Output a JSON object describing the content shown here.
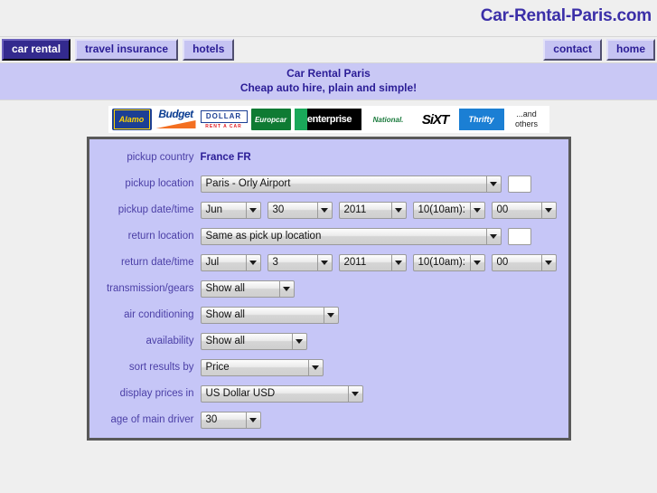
{
  "header": {
    "site_title": "Car-Rental-Paris.com"
  },
  "nav": {
    "left_items": [
      {
        "label": "car rental",
        "active": true
      },
      {
        "label": "travel insurance",
        "active": false
      },
      {
        "label": "hotels",
        "active": false
      }
    ],
    "right_items": [
      {
        "label": "contact"
      },
      {
        "label": "home"
      }
    ]
  },
  "tagline": {
    "line1": "Car Rental Paris",
    "line2": "Cheap auto hire, plain and simple!"
  },
  "logos": [
    {
      "name": "alamo-logo",
      "text": "Alamo"
    },
    {
      "name": "budget-logo",
      "text": "Budget"
    },
    {
      "name": "dollar-logo",
      "text": "DOLLAR",
      "subtext": "RENT A CAR"
    },
    {
      "name": "europcar-logo",
      "text": "Europcar"
    },
    {
      "name": "enterprise-logo",
      "text": "enterprise"
    },
    {
      "name": "national-logo",
      "text": "National."
    },
    {
      "name": "sixt-logo",
      "text": "SiXT"
    },
    {
      "name": "thrifty-logo",
      "text": "Thrifty"
    },
    {
      "name": "and-others-label",
      "line1": "...and",
      "line2": "others"
    }
  ],
  "form": {
    "pickup_country": {
      "label": "pickup country",
      "value": "France FR"
    },
    "pickup_location": {
      "label": "pickup location",
      "value": "Paris - Orly Airport",
      "extra_input_value": ""
    },
    "pickup_datetime": {
      "label": "pickup date/time",
      "month": "Jun",
      "day": "30",
      "year": "2011",
      "hour": "10(10am):",
      "minute": "00"
    },
    "return_location": {
      "label": "return location",
      "value": "Same as pick up location",
      "extra_input_value": ""
    },
    "return_datetime": {
      "label": "return date/time",
      "month": "Jul",
      "day": "3",
      "year": "2011",
      "hour": "10(10am):",
      "minute": "00"
    },
    "transmission": {
      "label": "transmission/gears",
      "value": "Show all"
    },
    "air_conditioning": {
      "label": "air conditioning",
      "value": "Show all"
    },
    "availability": {
      "label": "availability",
      "value": "Show all"
    },
    "sort_results_by": {
      "label": "sort results by",
      "value": "Price"
    },
    "display_prices_in": {
      "label": "display prices in",
      "value": "US Dollar USD"
    },
    "age_of_main_driver": {
      "label": "age of main driver",
      "value": "30"
    }
  },
  "colors": {
    "page_bg": "#efefef",
    "brand_purple": "#2b1d96",
    "panel_bg": "#c6c6f7",
    "nav_btn_bg": "#c6c4f2",
    "nav_btn_active_bg": "#332a8e",
    "tagline_band_bg": "#c9c8f5",
    "label_text": "#4b3fa6"
  }
}
